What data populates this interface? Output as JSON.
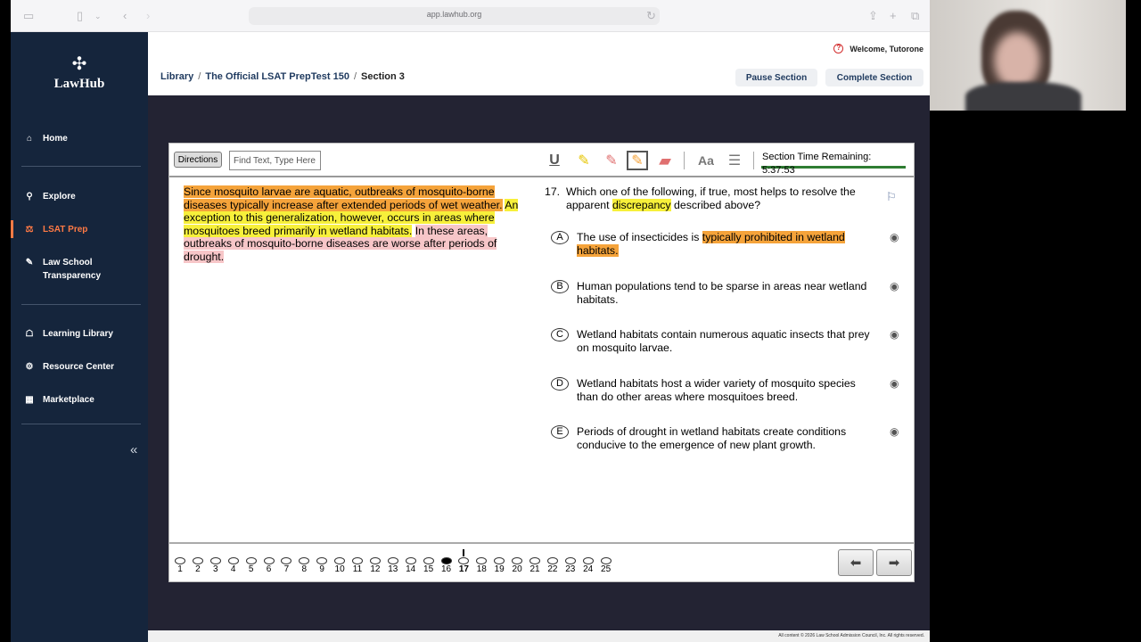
{
  "browser": {
    "url": "app.lawhub.org"
  },
  "sidebar": {
    "logo_text": "LawHub",
    "items": [
      {
        "label": "Home",
        "icon": "home-icon"
      },
      {
        "label": "Explore",
        "icon": "explore-icon"
      },
      {
        "label": "LSAT Prep",
        "icon": "lsat-prep-icon",
        "active": true
      },
      {
        "label": "Law School Transparency",
        "icon": "transparency-icon"
      },
      {
        "label": "Learning Library",
        "icon": "learning-library-icon"
      },
      {
        "label": "Resource Center",
        "icon": "resource-center-icon"
      },
      {
        "label": "Marketplace",
        "icon": "marketplace-icon"
      }
    ],
    "active_color": "#ff7a45"
  },
  "header": {
    "welcome": "Welcome, Tutorone",
    "breadcrumb": [
      "Library",
      "The Official LSAT PrepTest 150",
      "Section 3"
    ],
    "pause_button": "Pause Section",
    "complete_button": "Complete Section"
  },
  "toolbar": {
    "directions": "Directions",
    "find_placeholder": "Find Text, Type Here",
    "timer": "Section Time Remaining: 5:37:53"
  },
  "passage": {
    "segments": [
      {
        "text": "Since mosquito larvae are aquatic, outbreaks of mosquito-borne diseases typically increase after extended periods of wet weather.",
        "highlight": "orange"
      },
      {
        "text": " ",
        "highlight": "none"
      },
      {
        "text": "An exception to this generalization, however, occurs in areas where mosquitoes breed primarily in wetland habitats.",
        "highlight": "yellow"
      },
      {
        "text": " ",
        "highlight": "none"
      },
      {
        "text": "In these areas, outbreaks of mosquito-borne diseases are worse after periods of drought.",
        "highlight": "pink"
      }
    ]
  },
  "question": {
    "number": "17.",
    "stem_before": "Which one of the following, if true, most helps to resolve the apparent ",
    "stem_highlight": "discrepancy",
    "stem_after": " described above?",
    "answers": [
      {
        "letter": "A",
        "text_plain": "The use of insecticides is ",
        "text_highlight": "typically prohibited in wetland habitats."
      },
      {
        "letter": "B",
        "text_plain": "Human populations tend to be sparse in areas near wetland habitats.",
        "text_highlight": ""
      },
      {
        "letter": "C",
        "text_plain": "Wetland habitats contain numerous aquatic insects that prey on mosquito larvae.",
        "text_highlight": ""
      },
      {
        "letter": "D",
        "text_plain": "Wetland habitats host a wider variety of mosquito species than do other areas where mosquitoes breed.",
        "text_highlight": ""
      },
      {
        "letter": "E",
        "text_plain": "Periods of drought in wetland habitats create conditions conducive to the emergence of new plant growth.",
        "text_highlight": ""
      }
    ]
  },
  "nav": {
    "questions": [
      "1",
      "2",
      "3",
      "4",
      "5",
      "6",
      "7",
      "8",
      "9",
      "10",
      "11",
      "12",
      "13",
      "14",
      "15",
      "16",
      "17",
      "18",
      "19",
      "20",
      "21",
      "22",
      "23",
      "24",
      "25"
    ],
    "answered": [
      "16"
    ],
    "current": "17"
  },
  "footer": {
    "text": "All content © 2026 Law School Admission Council, Inc. All rights reserved."
  }
}
